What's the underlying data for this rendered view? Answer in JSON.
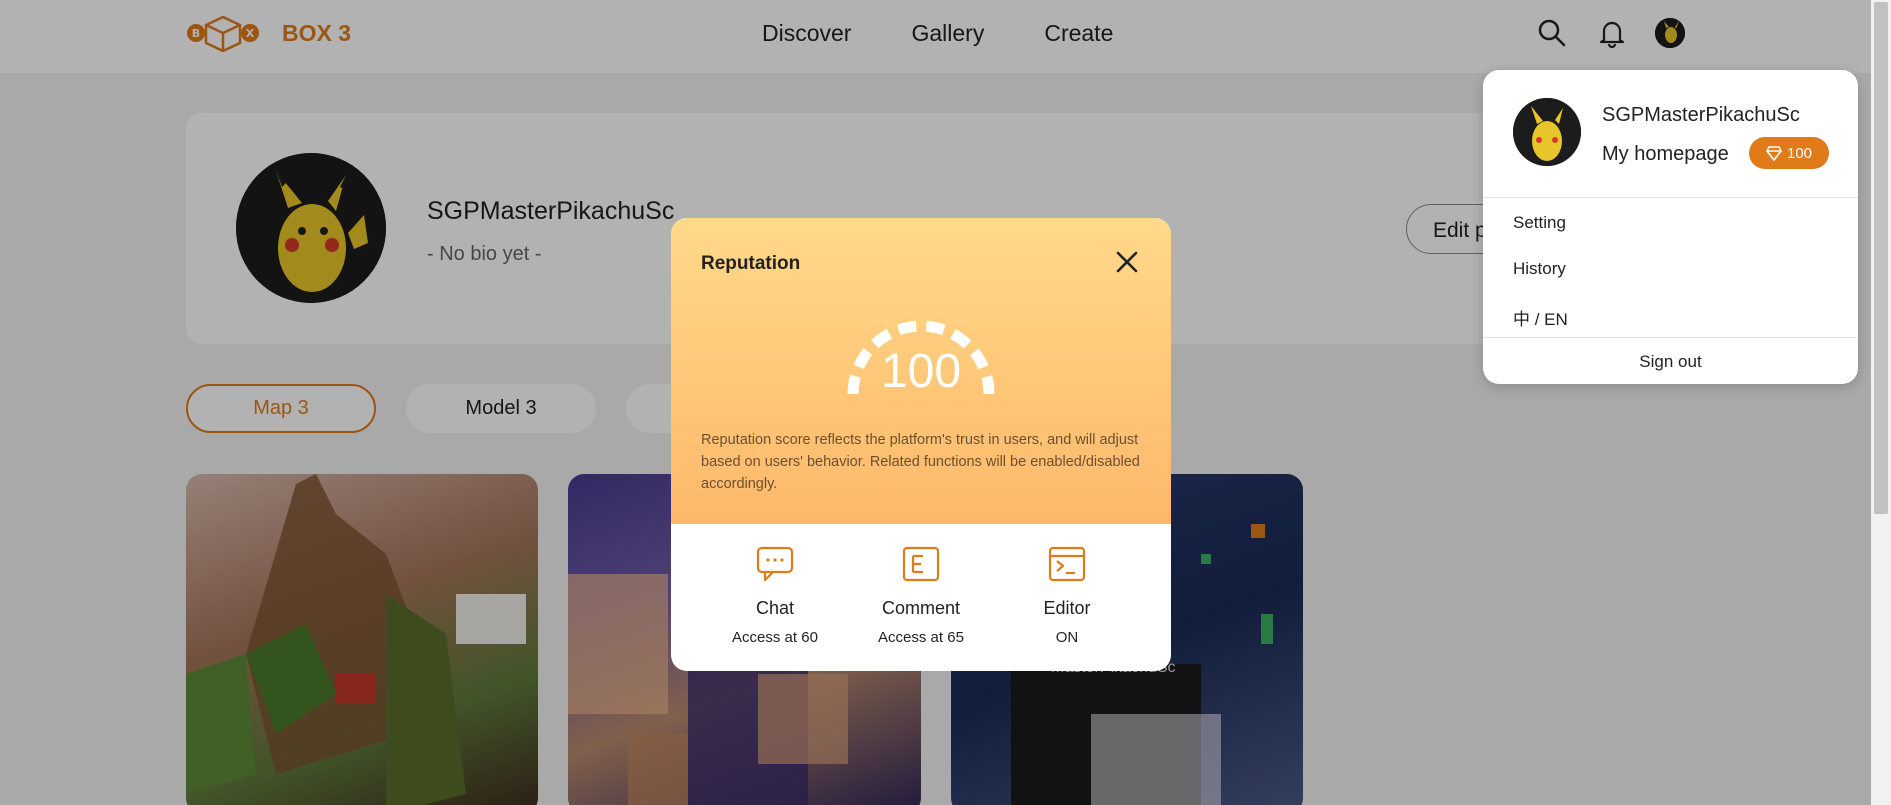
{
  "header": {
    "logo_text": "BOX 3",
    "nav": [
      "Discover",
      "Gallery",
      "Create"
    ]
  },
  "profile": {
    "name": "SGPMasterPikachuSc",
    "bio": "- No bio yet -",
    "edit_label": "Edit p"
  },
  "tabs": [
    "Map 3",
    "Model 3",
    ""
  ],
  "thumbnails": {
    "overlay_text": "MasterPikachuSc"
  },
  "dropdown": {
    "name": "SGPMasterPikachuSc",
    "homepage": "My homepage",
    "reputation_badge": "100",
    "items": [
      "Setting",
      "History",
      "中 / EN"
    ],
    "signout": "Sign out"
  },
  "modal": {
    "title": "Reputation",
    "score": "100",
    "description": "Reputation score reflects the platform's trust in users, and will adjust based on users' behavior. Related functions will be enabled/disabled accordingly.",
    "functions": [
      {
        "name": "Chat",
        "status": "Access at 60",
        "icon": "chat-icon"
      },
      {
        "name": "Comment",
        "status": "Access at 65",
        "icon": "comment-icon"
      },
      {
        "name": "Editor",
        "status": "ON",
        "icon": "editor-icon"
      }
    ]
  },
  "colors": {
    "accent": "#e07b1a",
    "modal_gradient_top": "#ffd98a",
    "modal_gradient_bottom": "#ffb86a"
  }
}
